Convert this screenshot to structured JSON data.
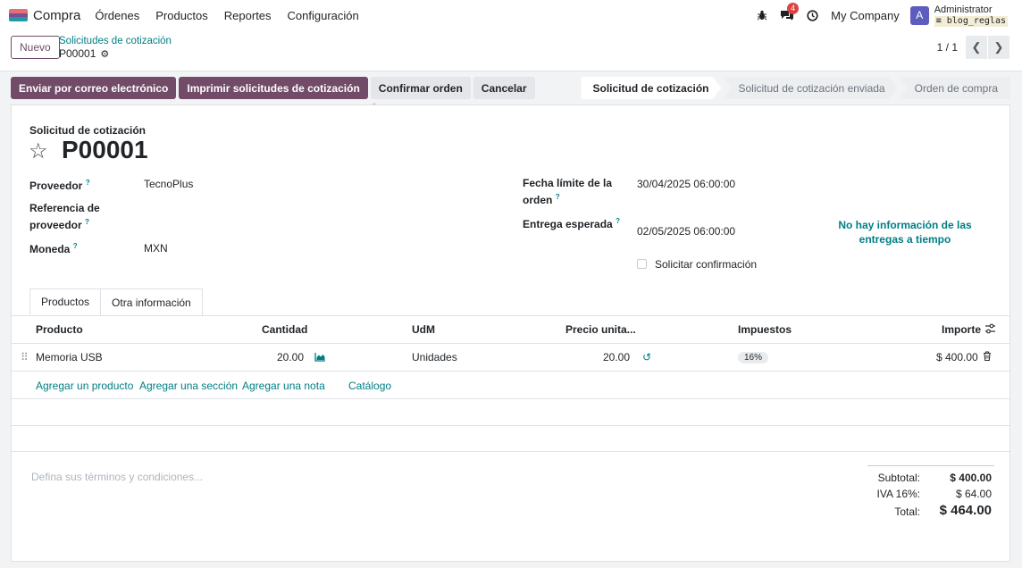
{
  "topbar": {
    "app_name": "Compra",
    "menu": [
      "Órdenes",
      "Productos",
      "Reportes",
      "Configuración"
    ],
    "chat_count": "4",
    "company": "My Company",
    "avatar_letter": "A",
    "user_name": "Administrator",
    "database": "blog_reglas"
  },
  "control_panel": {
    "new_button": "Nuevo",
    "breadcrumb_parent": "Solicitudes de cotización",
    "breadcrumb_current": "P00001",
    "pager": "1 / 1"
  },
  "actions": {
    "send_email": "Enviar por correo electrónico",
    "print": "Imprimir solicitudes de cotización",
    "confirm": "Confirmar orden",
    "cancel": "Cancelar"
  },
  "statusbar": [
    "Solicitud de cotización",
    "Solicitud de cotización enviada",
    "Orden de compra"
  ],
  "form": {
    "doc_type": "Solicitud de cotización",
    "name": "P00001",
    "fields": {
      "vendor_label": "Proveedor",
      "vendor": "TecnoPlus",
      "ref_label_1": "Referencia de",
      "ref_label_2": "proveedor",
      "currency_label": "Moneda",
      "currency": "MXN",
      "deadline_label_1": "Fecha límite de la",
      "deadline_label_2": "orden",
      "deadline": "30/04/2025 06:00:00",
      "expected_label": "Entrega esperada",
      "expected": "02/05/2025 06:00:00",
      "ontime_1": "No hay información de las",
      "ontime_2": "entregas a tiempo",
      "ask_confirm": "Solicitar confirmación"
    }
  },
  "tabs": [
    "Productos",
    "Otra información"
  ],
  "table": {
    "headers": {
      "product": "Producto",
      "qty": "Cantidad",
      "uom": "UdM",
      "price": "Precio unita...",
      "taxes": "Impuestos",
      "amount": "Importe"
    },
    "rows": [
      {
        "product": "Memoria USB",
        "qty": "20.00",
        "uom": "Unidades",
        "price": "20.00",
        "tax": "16%",
        "amount": "$ 400.00"
      }
    ],
    "add_links": [
      "Agregar un producto",
      "Agregar una sección",
      "Agregar una nota",
      "Catálogo"
    ]
  },
  "terms_placeholder": "Defina sus términos y condiciones...",
  "totals": {
    "subtotal_label": "Subtotal:",
    "subtotal": "$ 400.00",
    "tax_label": "IVA 16%:",
    "tax": "$ 64.00",
    "total_label": "Total:",
    "total": "$ 464.00"
  },
  "colors": {
    "primary": "#714b67",
    "accent": "#017e84",
    "annotation_arrow": "#f5924a"
  }
}
